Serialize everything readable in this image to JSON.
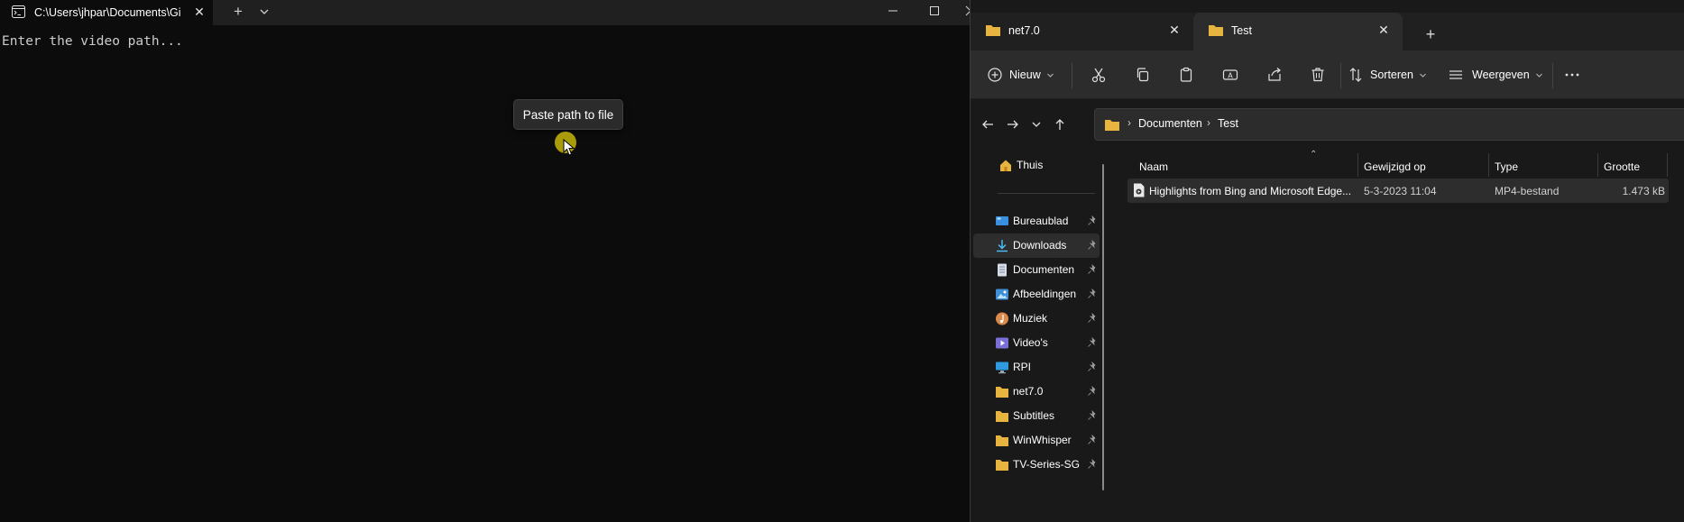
{
  "terminal": {
    "tab_title": "C:\\Users\\jhpar\\Documents\\Gi",
    "prompt_text": "Enter the video path...",
    "tooltip": "Paste path to file"
  },
  "explorer": {
    "tabs": [
      {
        "label": "net7.0"
      },
      {
        "label": "Test"
      }
    ],
    "toolbar": {
      "new_label": "Nieuw",
      "sort_label": "Sorteren",
      "view_label": "Weergeven"
    },
    "breadcrumb": [
      "Documenten",
      "Test"
    ],
    "nav": {
      "home": "Thuis",
      "items": [
        {
          "label": "Bureaublad",
          "icon": "desktop-icon"
        },
        {
          "label": "Downloads",
          "icon": "download-icon"
        },
        {
          "label": "Documenten",
          "icon": "document-icon"
        },
        {
          "label": "Afbeeldingen",
          "icon": "pictures-icon"
        },
        {
          "label": "Muziek",
          "icon": "music-icon"
        },
        {
          "label": "Video's",
          "icon": "video-icon"
        },
        {
          "label": "RPI",
          "icon": "computer-icon"
        },
        {
          "label": "net7.0",
          "icon": "folder-icon"
        },
        {
          "label": "Subtitles",
          "icon": "folder-icon"
        },
        {
          "label": "WinWhisper",
          "icon": "folder-icon"
        },
        {
          "label": "TV-Series-SG",
          "icon": "folder-icon"
        }
      ]
    },
    "columns": {
      "name": "Naam",
      "modified": "Gewijzigd op",
      "type": "Type",
      "size": "Grootte"
    },
    "files": [
      {
        "name": "Highlights from Bing and Microsoft Edge...",
        "modified": "5-3-2023 11:04",
        "type": "MP4-bestand",
        "size": "1.473 kB"
      }
    ],
    "colors": {
      "folder": "#e8b440",
      "accent": "#4cc2ff"
    }
  }
}
